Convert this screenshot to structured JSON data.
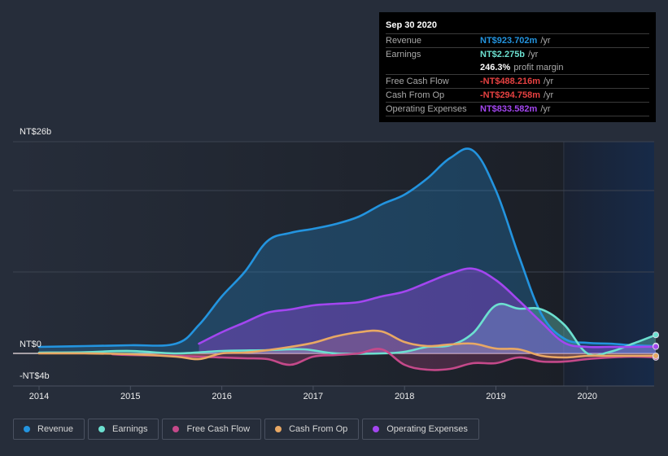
{
  "tooltip": {
    "date": "Sep 30 2020",
    "rows": [
      {
        "label": "Revenue",
        "value": "NT$923.702m",
        "unit": "/yr",
        "color": "#2394df"
      },
      {
        "label": "Earnings",
        "value": "NT$2.275b",
        "unit": "/yr",
        "color": "#6ce0d0"
      },
      {
        "label": "",
        "value": "246.3%",
        "unit": "profit margin",
        "color": "#ffffff"
      },
      {
        "label": "Free Cash Flow",
        "value": "-NT$488.216m",
        "unit": "/yr",
        "color": "#e64141"
      },
      {
        "label": "Cash From Op",
        "value": "-NT$294.758m",
        "unit": "/yr",
        "color": "#e64141"
      },
      {
        "label": "Operating Expenses",
        "value": "NT$833.582m",
        "unit": "/yr",
        "color": "#a346f0"
      }
    ]
  },
  "legend": [
    {
      "label": "Revenue",
      "color": "#2394df"
    },
    {
      "label": "Earnings",
      "color": "#6ce0d0"
    },
    {
      "label": "Free Cash Flow",
      "color": "#c5498a"
    },
    {
      "label": "Cash From Op",
      "color": "#e8a864"
    },
    {
      "label": "Operating Expenses",
      "color": "#a346f0"
    }
  ],
  "chart_data": {
    "type": "area",
    "title": "",
    "xlabel": "",
    "ylabel": "",
    "ylim": [
      -4,
      26
    ],
    "xlim": [
      2013.87,
      2020.75
    ],
    "y_tick_labels": [
      "NT$26b",
      "NT$0",
      "-NT$4b"
    ],
    "y_ticks": [
      26,
      0,
      -4
    ],
    "gridlines_y": [
      26,
      20,
      10,
      0
    ],
    "x_tick_labels": [
      "2014",
      "2015",
      "2016",
      "2017",
      "2018",
      "2019",
      "2020"
    ],
    "x_ticks": [
      2014,
      2015,
      2016,
      2017,
      2018,
      2019,
      2020
    ],
    "units": "NT$ billions",
    "forecast_region_start": 2019.75,
    "series": [
      {
        "name": "Revenue",
        "color": "#2394df",
        "x": [
          2014,
          2014.5,
          2015,
          2015.5,
          2015.75,
          2016,
          2016.25,
          2016.5,
          2016.75,
          2017,
          2017.25,
          2017.5,
          2017.75,
          2018,
          2018.25,
          2018.5,
          2018.75,
          2019,
          2019.25,
          2019.5,
          2019.75,
          2020,
          2020.25,
          2020.5,
          2020.75
        ],
        "values": [
          0.8,
          0.9,
          1.0,
          1.2,
          3.5,
          7.0,
          10.0,
          13.8,
          14.8,
          15.3,
          15.9,
          16.8,
          18.3,
          19.5,
          21.5,
          24.0,
          24.9,
          20.0,
          12.0,
          4.8,
          1.8,
          1.3,
          1.2,
          1.0,
          0.92
        ]
      },
      {
        "name": "Earnings",
        "color": "#6ce0d0",
        "x": [
          2014,
          2014.5,
          2015,
          2015.5,
          2016,
          2016.5,
          2016.9,
          2017.25,
          2017.75,
          2018,
          2018.25,
          2018.5,
          2018.75,
          2019,
          2019.25,
          2019.5,
          2019.75,
          2020,
          2020.25,
          2020.5,
          2020.75
        ],
        "values": [
          0.1,
          0.15,
          0.3,
          0.0,
          0.3,
          0.4,
          0.5,
          0.0,
          0.0,
          0.2,
          0.8,
          1.0,
          2.5,
          5.9,
          5.5,
          5.4,
          3.5,
          0.0,
          0.2,
          1.2,
          2.275
        ]
      },
      {
        "name": "Free Cash Flow",
        "color": "#c5498a",
        "x": [
          2014.8,
          2015,
          2015.5,
          2016,
          2016.25,
          2016.5,
          2016.75,
          2017,
          2017.25,
          2017.5,
          2017.75,
          2018,
          2018.25,
          2018.5,
          2018.75,
          2019,
          2019.25,
          2019.5,
          2019.75,
          2020,
          2020.25,
          2020.5,
          2020.75
        ],
        "values": [
          -0.1,
          -0.2,
          -0.3,
          -0.5,
          -0.6,
          -0.7,
          -1.4,
          -0.4,
          -0.2,
          0.0,
          0.5,
          -1.4,
          -2.0,
          -1.9,
          -1.2,
          -1.2,
          -0.5,
          -1.0,
          -1.0,
          -0.7,
          -0.5,
          -0.4,
          -0.488
        ]
      },
      {
        "name": "Cash From Op",
        "color": "#e8a864",
        "x": [
          2014,
          2014.5,
          2015,
          2015.5,
          2015.75,
          2016,
          2016.25,
          2016.5,
          2016.75,
          2017,
          2017.25,
          2017.5,
          2017.75,
          2018,
          2018.25,
          2018.5,
          2018.75,
          2019,
          2019.25,
          2019.5,
          2019.75,
          2020,
          2020.25,
          2020.5,
          2020.75
        ],
        "values": [
          0.0,
          0.0,
          -0.1,
          -0.4,
          -0.7,
          0.0,
          0.1,
          0.4,
          0.8,
          1.3,
          2.1,
          2.6,
          2.7,
          1.4,
          0.9,
          1.1,
          1.2,
          0.6,
          0.5,
          -0.3,
          -0.5,
          -0.3,
          -0.3,
          -0.3,
          -0.295
        ]
      },
      {
        "name": "Operating Expenses",
        "color": "#a346f0",
        "x": [
          2015.75,
          2016,
          2016.25,
          2016.5,
          2016.75,
          2017,
          2017.25,
          2017.5,
          2017.75,
          2018,
          2018.25,
          2018.5,
          2018.75,
          2019,
          2019.25,
          2019.5,
          2019.75,
          2020,
          2020.25,
          2020.5,
          2020.75
        ],
        "values": [
          1.2,
          2.6,
          3.8,
          5.0,
          5.4,
          5.9,
          6.1,
          6.3,
          7.0,
          7.6,
          8.7,
          9.8,
          10.4,
          9.0,
          6.5,
          3.8,
          1.3,
          0.8,
          0.8,
          0.8,
          0.834
        ]
      }
    ]
  }
}
